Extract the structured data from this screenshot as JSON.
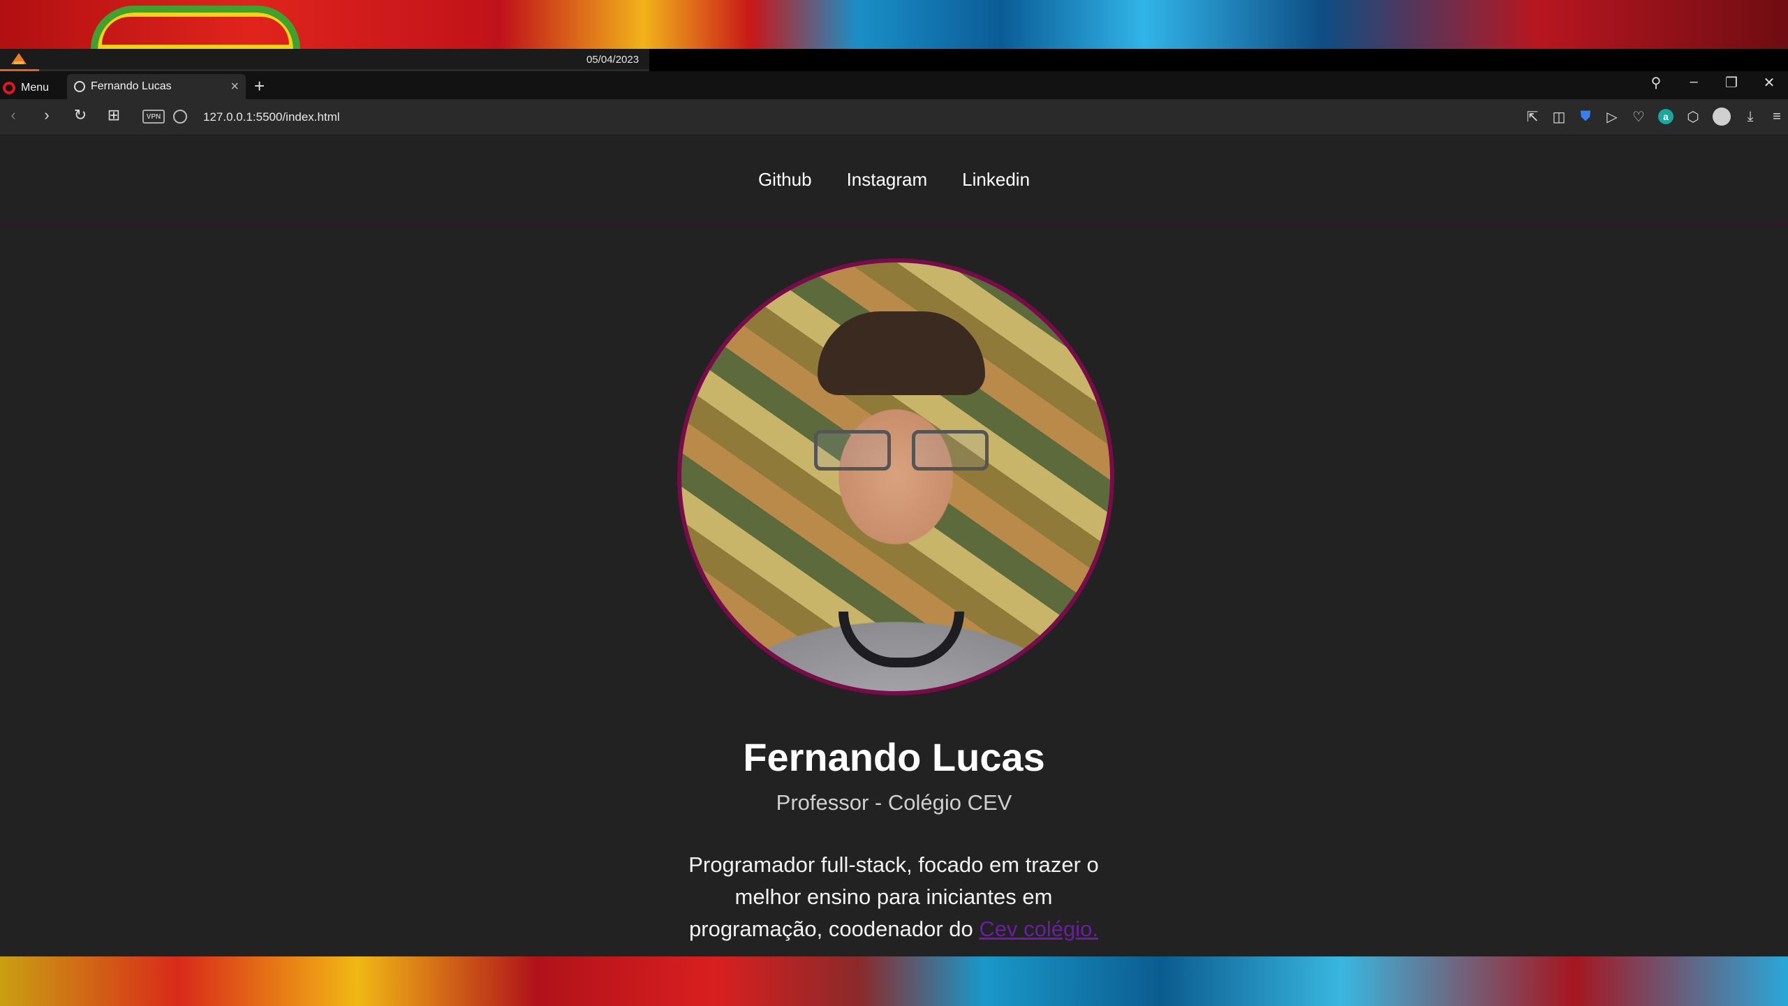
{
  "system": {
    "date": "05/04/2023"
  },
  "browser": {
    "menu_label": "Menu",
    "tab_title": "Fernando Lucas",
    "url": "127.0.0.1:5500/index.html",
    "vpn_label": "VPN"
  },
  "nav": {
    "links": [
      "Github",
      "Instagram",
      "Linkedin"
    ]
  },
  "profile": {
    "name": "Fernando Lucas",
    "role": "Professor - Colégio CEV",
    "bio_text": "Programador full-stack, focado em trazer o melhor ensino para iniciantes em programação, coodenador do",
    "bio_link": "Cev colégio."
  },
  "colors": {
    "page_bg": "#222222",
    "avatar_border": "#7a0b4a",
    "link": "#6b1fa0"
  }
}
